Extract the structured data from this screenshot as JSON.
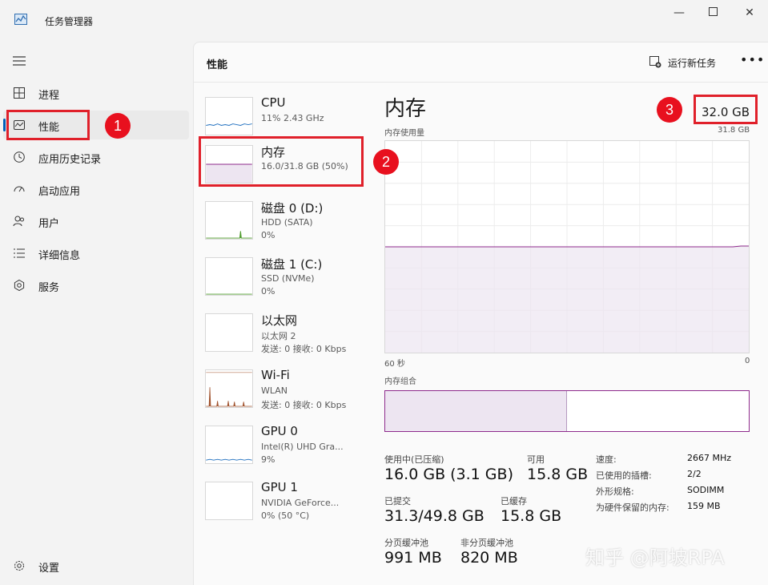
{
  "window": {
    "title": "任务管理器"
  },
  "nav": {
    "items": [
      {
        "label": "进程"
      },
      {
        "label": "性能"
      },
      {
        "label": "应用历史记录"
      },
      {
        "label": "启动应用"
      },
      {
        "label": "用户"
      },
      {
        "label": "详细信息"
      },
      {
        "label": "服务"
      }
    ],
    "settings": "设置"
  },
  "header": {
    "title": "性能",
    "run_task": "运行新任务"
  },
  "resources": [
    {
      "name": "CPU",
      "sub1": "11% 2.43 GHz",
      "sub2": ""
    },
    {
      "name": "内存",
      "sub1": "16.0/31.8 GB (50%)",
      "sub2": ""
    },
    {
      "name": "磁盘 0 (D:)",
      "sub1": "HDD (SATA)",
      "sub2": "0%"
    },
    {
      "name": "磁盘 1 (C:)",
      "sub1": "SSD (NVMe)",
      "sub2": "0%"
    },
    {
      "name": "以太网",
      "sub1": "以太网 2",
      "sub2": "发送: 0 接收: 0 Kbps"
    },
    {
      "name": "Wi-Fi",
      "sub1": "WLAN",
      "sub2": "发送: 0 接收: 0 Kbps"
    },
    {
      "name": "GPU 0",
      "sub1": "Intel(R) UHD Gra...",
      "sub2": "9%"
    },
    {
      "name": "GPU 1",
      "sub1": "NVIDIA GeForce...",
      "sub2": "0% (50 °C)"
    }
  ],
  "detail": {
    "title": "内存",
    "total": "32.0 GB",
    "usage_label": "内存使用量",
    "max_label": "31.8 GB",
    "time_left": "60 秒",
    "time_right": "0",
    "composition_label": "内存组合",
    "usage_fraction": 0.5,
    "composition_used_fraction": 0.5,
    "stats": {
      "in_use_label": "使用中(已压缩)",
      "in_use": "16.0 GB (3.1 GB)",
      "available_label": "可用",
      "available": "15.8 GB",
      "committed_label": "已提交",
      "committed": "31.3/49.8 GB",
      "cached_label": "已缓存",
      "cached": "15.8 GB",
      "paged_label": "分页缓冲池",
      "paged": "991 MB",
      "nonpaged_label": "非分页缓冲池",
      "nonpaged": "820 MB"
    },
    "kv": [
      {
        "k": "速度:",
        "v": "2667 MHz"
      },
      {
        "k": "已使用的插槽:",
        "v": "2/2"
      },
      {
        "k": "外形规格:",
        "v": "SODIMM"
      },
      {
        "k": "为硬件保留的内存:",
        "v": "159 MB"
      }
    ]
  },
  "annotations": {
    "b1": "1",
    "b2": "2",
    "b3": "3"
  },
  "watermark": "知乎 @阿坡RPA",
  "colors": {
    "memory": "#8e2a8c",
    "cpu": "#1f6fbf",
    "disk": "#4c9a2a",
    "wifi": "#a0522d",
    "highlight": "#e0202a"
  }
}
